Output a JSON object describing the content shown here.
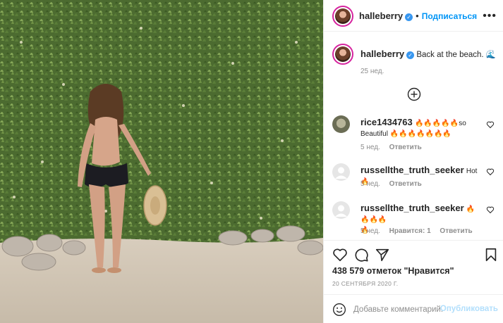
{
  "post": {
    "author": "halleberry",
    "follow_label": "Подписаться",
    "more_icon": "more-options-icon",
    "caption_text": "Back at the beach.",
    "caption_emoji": "🌊",
    "caption_time": "25 нед."
  },
  "comments": [
    {
      "user": "rice1434763",
      "text_line1": "🔥🔥🔥🔥🔥so",
      "text_line2": "Beautiful 🔥🔥🔥🔥🔥🔥🔥",
      "time": "5 нед.",
      "reply": "Ответить"
    },
    {
      "user": "russellthe_truth_seeker",
      "text": "Hot🔥",
      "time": "5 нед.",
      "reply": "Ответить"
    },
    {
      "user": "russellthe_truth_seeker",
      "text_line1": "🔥🔥🔥🔥",
      "text_line2": "🔥",
      "time": "5 нед.",
      "likes": "Нравится: 1",
      "reply": "Ответить"
    }
  ],
  "actions": {
    "likes_text": "438 579 отметок \"Нравится\"",
    "date_text": "20 СЕНТЯБРЯ 2020 Г.",
    "comment_placeholder": "Добавьте комментарий...",
    "publish_label": "Опубликовать"
  },
  "colors": {
    "link_blue": "#0095f6",
    "verified_blue": "#3897f0",
    "muted": "#8e8e8e",
    "border": "#efefef"
  }
}
